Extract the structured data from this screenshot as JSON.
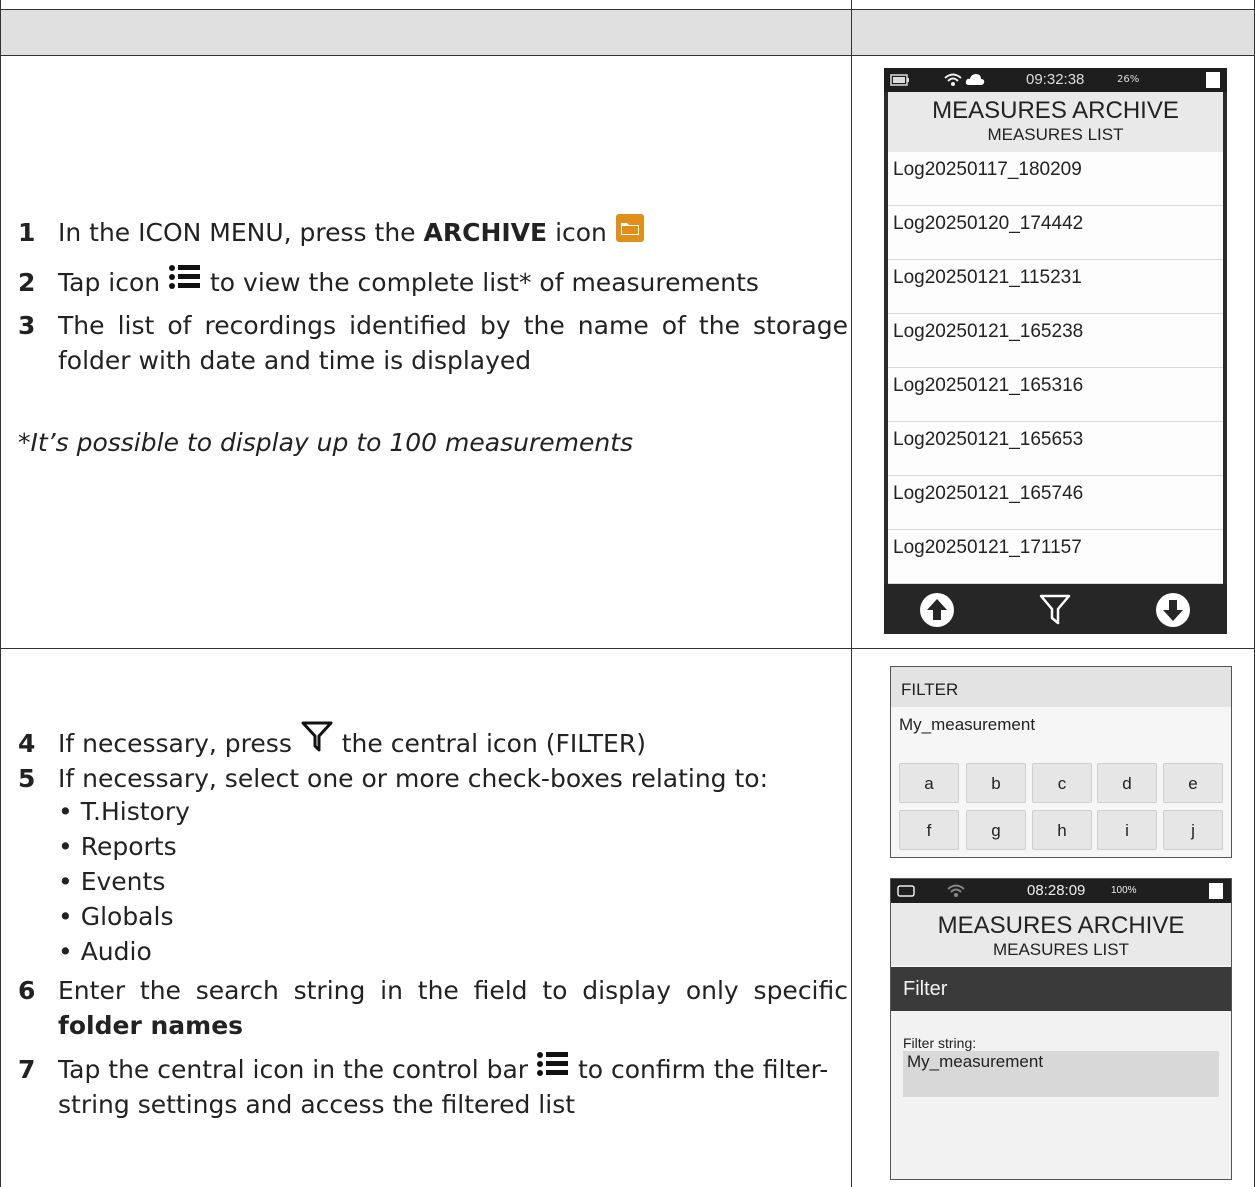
{
  "steps": [
    {
      "num": "1",
      "pre": "In the ICON MENU, press the ",
      "bold": "ARCHIVE",
      "post": " icon"
    },
    {
      "num": "2",
      "pre": "Tap icon ",
      "post": " to view the complete list* of measurements"
    },
    {
      "num": "3",
      "text": "The list of recordings identified by the name of the storage folder with date and time is displayed"
    },
    {
      "num": "4",
      "pre": "If necessary, press ",
      "post": " the central icon (FILTER)"
    },
    {
      "num": "5",
      "text": "If necessary, select one or more check-boxes relating to:"
    },
    {
      "num": "6",
      "pre": "Enter the search string in the field to display only specific ",
      "bold": "folder names"
    },
    {
      "num": "7",
      "pre": "Tap the central icon in the control bar ",
      "post": " to confirm the filter-string settings and access the filtered list"
    }
  ],
  "note": "*It’s possible to display up to 100 measurements",
  "bullets": [
    "T.History",
    "Reports",
    "Events",
    "Globals",
    "Audio"
  ],
  "screen1": {
    "time": "09:32:38",
    "percent": "26%",
    "title": "MEASURES ARCHIVE",
    "subtitle": "MEASURES LIST",
    "rows": [
      "Log20250117_180209",
      "Log20250120_174442",
      "Log20250121_115231",
      "Log20250121_165238",
      "Log20250121_165316",
      "Log20250121_165653",
      "Log20250121_165746",
      "Log20250121_171157"
    ]
  },
  "screen2": {
    "title": "FILTER",
    "text": "My_measurement",
    "keys_row1": [
      "a",
      "b",
      "c",
      "d",
      "e"
    ],
    "keys_row2": [
      "f",
      "g",
      "h",
      "i",
      "j"
    ]
  },
  "screen3": {
    "time": "08:28:09",
    "percent": "100%",
    "title": "MEASURES ARCHIVE",
    "subtitle": "MEASURES LIST",
    "filter_bar": "Filter",
    "filter_label": "Filter string:",
    "filter_value": "My_measurement"
  },
  "icons": [
    "folder-icon",
    "list-icon",
    "filter-icon",
    "arrow-up-icon",
    "arrow-down-icon",
    "battery-icon",
    "wifi-icon",
    "cloud-icon"
  ],
  "colors": {
    "folder_orange": "#e0901a",
    "header_gray": "#e0e0e0",
    "device_dark": "#2b2b2b"
  }
}
